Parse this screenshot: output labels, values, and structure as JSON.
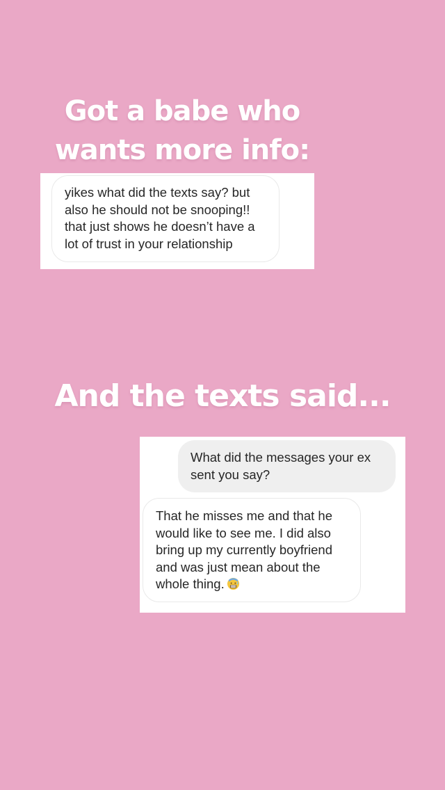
{
  "background_color": "#eaa8c6",
  "headline_top": "Got a babe who wants more info:",
  "screenshot_1": {
    "message": "yikes what did the texts say? but\nalso he should not be snooping!!\nthat just shows he doesn’t have a\nlot of trust in your relationship"
  },
  "headline_bottom": "And the texts said...",
  "screenshot_2": {
    "question": "What did the messages your ex\nsent you say?",
    "reply": "That he misses me and that he\nwould like to see me. I did also\nbring up my currently boyfriend\nand was just mean about the\nwhole thing.",
    "reply_emoji": "grimacing-face-with-sweat-icon"
  }
}
